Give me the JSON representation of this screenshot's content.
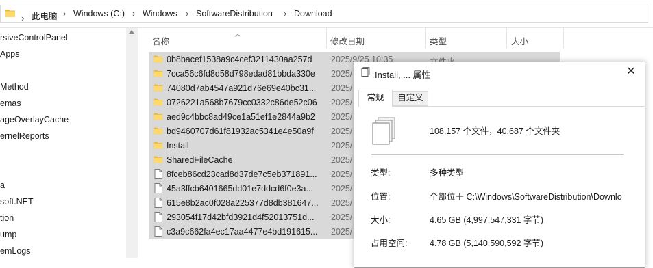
{
  "address": {
    "crumbs": [
      "此电脑",
      "Windows (C:)",
      "Windows",
      "SoftwareDistribution",
      "Download"
    ],
    "separator": "›"
  },
  "nav": {
    "items": [
      "rsiveControlPanel",
      "Apps",
      "",
      "Method",
      "emas",
      "ageOverlayCache",
      "ernelReports",
      "",
      "",
      "a",
      "soft.NET",
      "tion",
      "ump",
      "emLogs"
    ]
  },
  "columns": {
    "name": "名称",
    "date": "修改日期",
    "type": "类型",
    "size": "大小",
    "sort_glyph": "︿"
  },
  "files": [
    {
      "name": "0b8bacef1538a9c4cef3211430aa257d",
      "date": "2025/9/25 10:35",
      "type": "文件夹",
      "kind": "folder"
    },
    {
      "name": "7cca56c6fd8d58d798edad81bbda330e",
      "date": "2025/",
      "type": "",
      "kind": "folder"
    },
    {
      "name": "74080d7ab4547a921d76e69e40bc31...",
      "date": "2025/",
      "type": "",
      "kind": "folder"
    },
    {
      "name": "0726221a568b7679cc0332c86de52c06",
      "date": "2025/",
      "type": "",
      "kind": "folder"
    },
    {
      "name": "aed9c4bbc8ad49ce1a51ef1e2844a9b2",
      "date": "2025/",
      "type": "",
      "kind": "folder"
    },
    {
      "name": "bd9460707d61f81932ac5341e4e50a9f",
      "date": "2025/",
      "type": "",
      "kind": "folder"
    },
    {
      "name": "Install",
      "date": "2025/",
      "type": "",
      "kind": "folder"
    },
    {
      "name": "SharedFileCache",
      "date": "2025/",
      "type": "",
      "kind": "folder"
    },
    {
      "name": "8fceb86cd23cad8d37de7c5eb371891...",
      "date": "2025/",
      "type": "",
      "kind": "file"
    },
    {
      "name": "45a3ffcb6401665dd01e7ddcd6f0e3a...",
      "date": "2025/",
      "type": "",
      "kind": "file"
    },
    {
      "name": "615e8b2ac0f028a225377d8db381647...",
      "date": "2025/",
      "type": "",
      "kind": "file"
    },
    {
      "name": "293054f17d42bfd3921d4f52013751d...",
      "date": "2025/",
      "type": "",
      "kind": "file"
    },
    {
      "name": "c3a9c662fa4ec17aa4477e4bd191615...",
      "date": "2025/",
      "type": "",
      "kind": "file"
    }
  ],
  "dialog": {
    "title": "Install, ... 属性",
    "close_glyph": "✕",
    "tabs": [
      "常规",
      "自定义"
    ],
    "summary": "108,157 个文件，40,687 个文件夹",
    "props": [
      {
        "label": "类型:",
        "value": "多种类型"
      },
      {
        "label": "位置:",
        "value": "全部位于 C:\\Windows\\SoftwareDistribution\\Downlo"
      },
      {
        "label": "大小:",
        "value": "4.65 GB (4,997,547,331 字节)"
      },
      {
        "label": "占用空间:",
        "value": "4.78 GB (5,140,590,592 字节)"
      }
    ]
  },
  "colors": {
    "selection": "#d9d9d9",
    "folder": "#ffd96b",
    "folder_dark": "#e8b83a"
  }
}
